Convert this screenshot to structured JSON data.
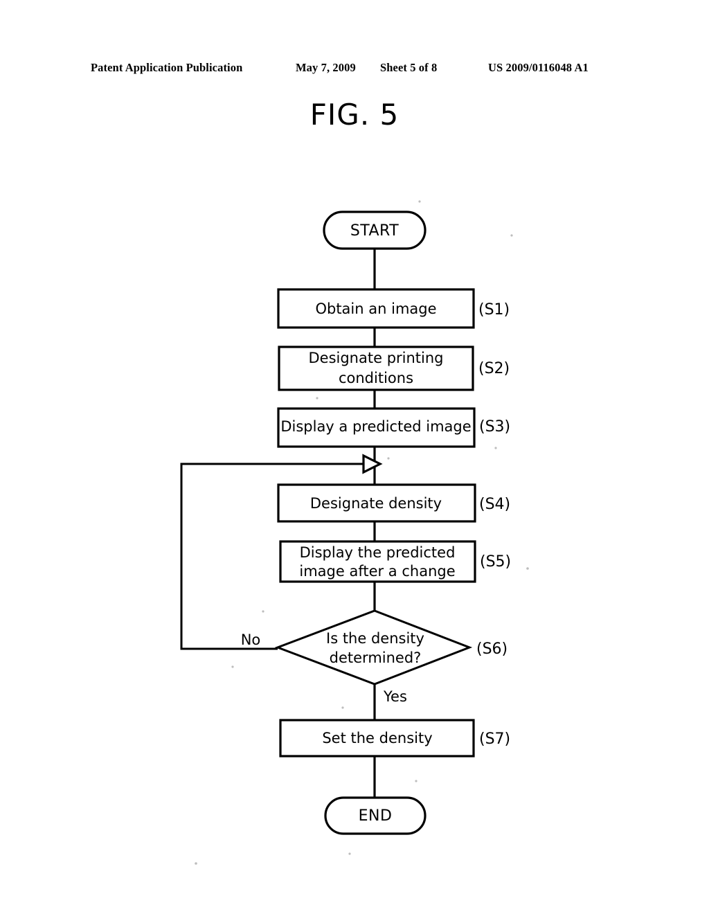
{
  "header": {
    "publication": "Patent Application Publication",
    "date": "May 7, 2009",
    "sheet": "Sheet 5 of 8",
    "number": "US 2009/0116048 A1"
  },
  "figure": {
    "title": "FIG. 5",
    "type": "flowchart",
    "nodes": [
      {
        "id": "start",
        "shape": "terminator",
        "label": "START",
        "step": ""
      },
      {
        "id": "s1",
        "shape": "process",
        "label": "Obtain an image",
        "step": "(S1)"
      },
      {
        "id": "s2",
        "shape": "process",
        "label_line1": "Designate printing",
        "label_line2": "conditions",
        "step": "(S2)"
      },
      {
        "id": "s3",
        "shape": "process",
        "label": "Display a predicted image",
        "step": "(S3)"
      },
      {
        "id": "s4",
        "shape": "process",
        "label": "Designate density",
        "step": "(S4)"
      },
      {
        "id": "s5",
        "shape": "process",
        "label_line1": "Display the predicted",
        "label_line2": "image after a change",
        "step": "(S5)"
      },
      {
        "id": "s6",
        "shape": "decision",
        "label_line1": "Is the density",
        "label_line2": "determined?",
        "step": "(S6)"
      },
      {
        "id": "s7",
        "shape": "process",
        "label": "Set the density",
        "step": "(S7)"
      },
      {
        "id": "end",
        "shape": "terminator",
        "label": "END",
        "step": ""
      }
    ],
    "branches": {
      "no": "No",
      "yes": "Yes"
    },
    "colors": {
      "ink": "#000000",
      "paper": "#ffffff"
    }
  }
}
